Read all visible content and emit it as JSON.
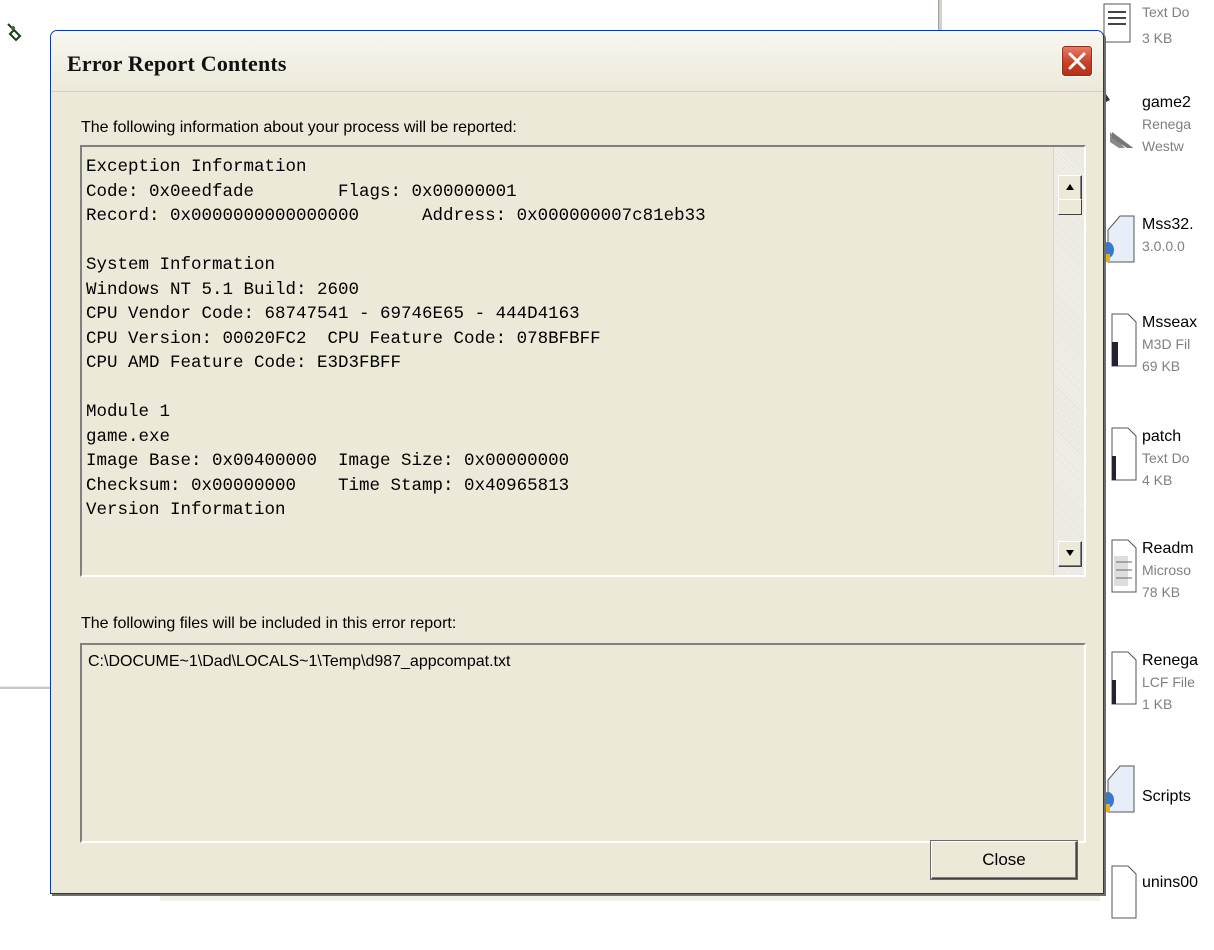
{
  "dialog": {
    "title": "Error Report Contents",
    "process_label": "The following information about your process will be reported:",
    "report_lines": [
      "Exception Information",
      "Code: 0x0eedfade        Flags: 0x00000001",
      "Record: 0x0000000000000000      Address: 0x000000007c81eb33",
      "",
      "System Information",
      "Windows NT 5.1 Build: 2600",
      "CPU Vendor Code: 68747541 - 69746E65 - 444D4163",
      "CPU Version: 00020FC2  CPU Feature Code: 078BFBFF",
      "CPU AMD Feature Code: E3D3FBFF",
      "",
      "Module 1",
      "game.exe",
      "Image Base: 0x00400000  Image Size: 0x00000000",
      "Checksum: 0x00000000    Time Stamp: 0x40965813",
      "Version Information"
    ],
    "files_label": "The following files will be included in this error report:",
    "files": [
      "C:\\DOCUME~1\\Dad\\LOCALS~1\\Temp\\d987_appcompat.txt"
    ],
    "close_label": "Close"
  },
  "background_files": [
    {
      "name": "",
      "line1": "Text Do",
      "line2": "3 KB",
      "icon": "text-document-icon"
    },
    {
      "name": "game2",
      "line1": "Renega",
      "line2": "Westw",
      "icon": "game-shortcut-icon"
    },
    {
      "name": "Mss32.",
      "line1": "3.0.0.0",
      "line2": "",
      "icon": "dll-file-icon"
    },
    {
      "name": "Msseax",
      "line1": "M3D Fil",
      "line2": "69 KB",
      "icon": "generic-file-icon"
    },
    {
      "name": "patch",
      "line1": "Text Do",
      "line2": "4 KB",
      "icon": "generic-file-icon"
    },
    {
      "name": "Readm",
      "line1": "Microso",
      "line2": "78 KB",
      "icon": "text-document-icon"
    },
    {
      "name": "Renega",
      "line1": "LCF File",
      "line2": "1 KB",
      "icon": "generic-file-icon"
    },
    {
      "name": "Scripts",
      "line1": "",
      "line2": "",
      "icon": "folder-icon"
    },
    {
      "name": "unins00",
      "line1": "",
      "line2": "",
      "icon": "generic-file-icon"
    }
  ],
  "colors": {
    "dialog_face": "#ece9d8",
    "title_border": "#0b3b9b",
    "close_red": "#c8402a",
    "secondary_text": "#7f7f7f"
  }
}
